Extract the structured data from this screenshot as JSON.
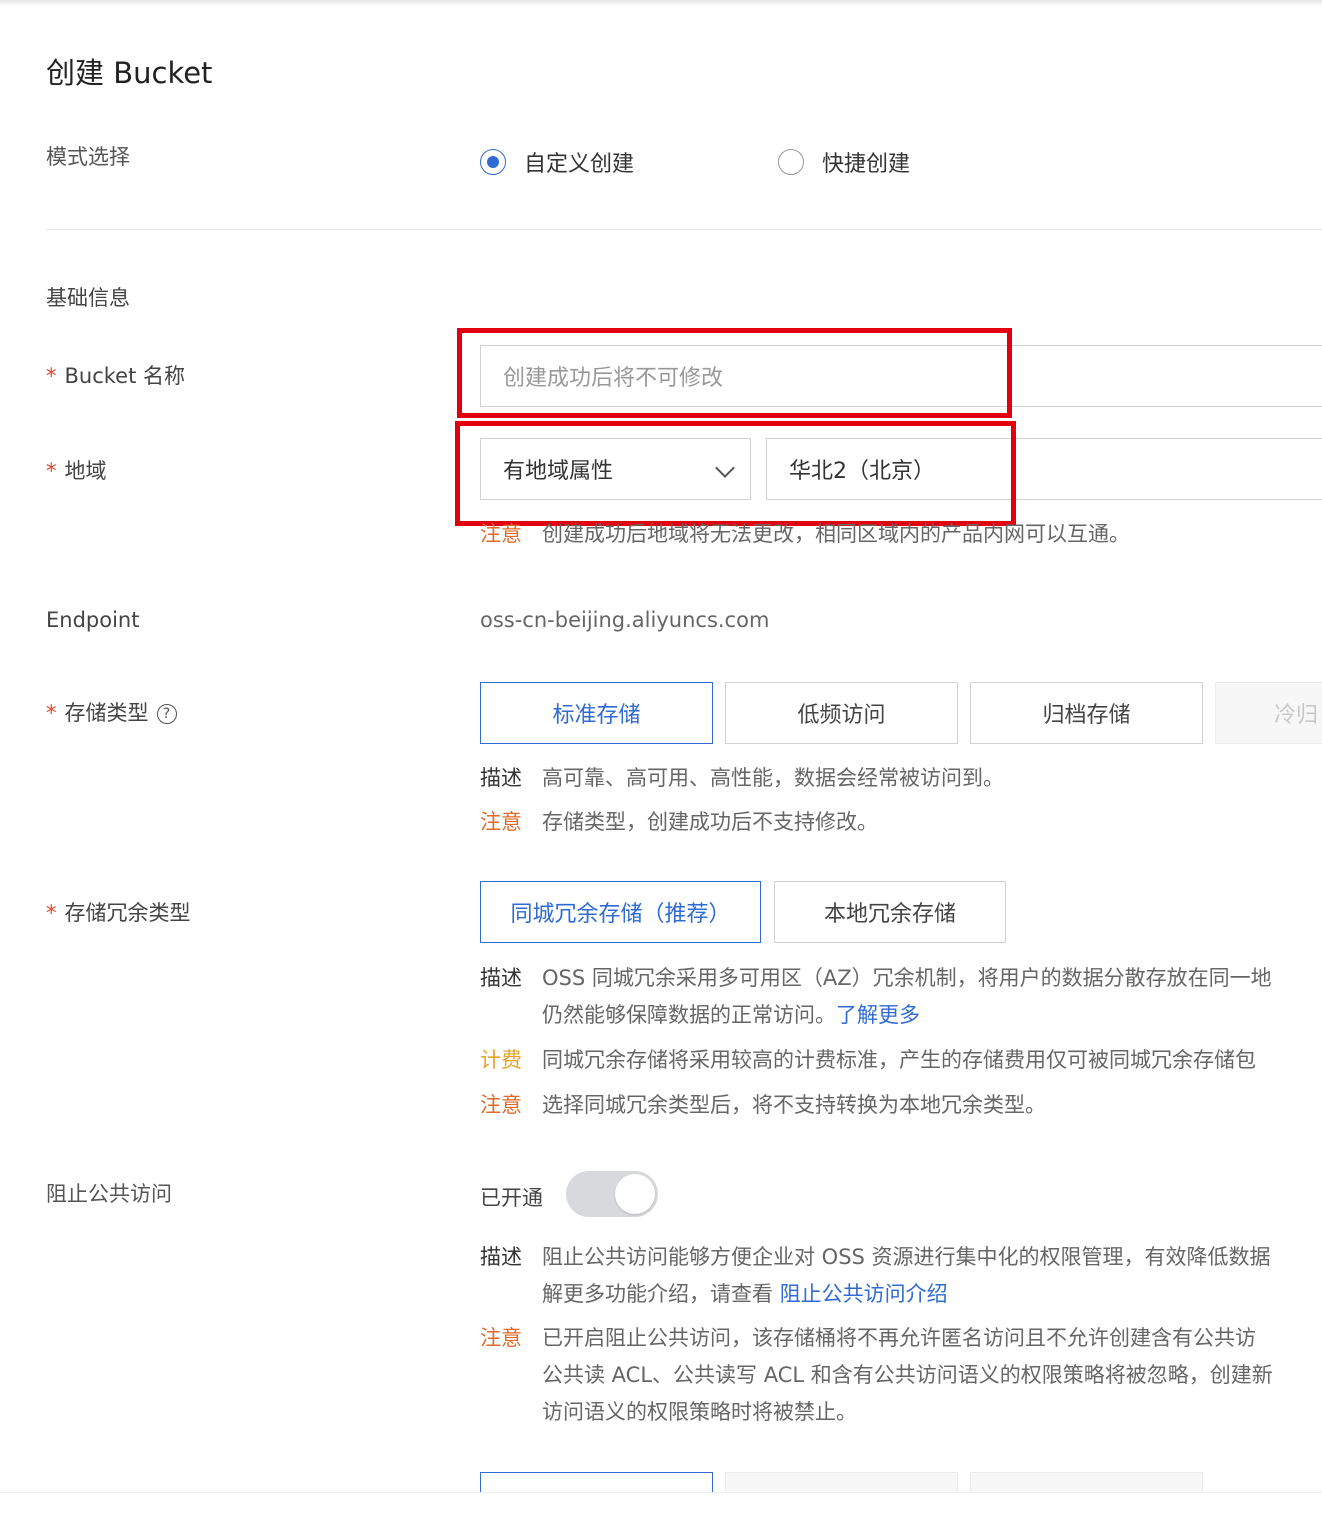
{
  "page": {
    "title": "创建 Bucket"
  },
  "mode": {
    "label": "模式选择",
    "options": [
      "自定义创建",
      "快捷创建"
    ],
    "selected": "自定义创建"
  },
  "basic": {
    "section_title": "基础信息",
    "bucket_name": {
      "required_mark": "*",
      "label": "Bucket 名称",
      "placeholder": "创建成功后将不可修改"
    },
    "region": {
      "required_mark": "*",
      "label": "地域",
      "type_value": "有地域属性",
      "region_value": "华北2（北京）",
      "note_key": "注意",
      "note_text": "创建成功后地域将无法更改，相同区域内的产品内网可以互通。"
    },
    "endpoint": {
      "label": "Endpoint",
      "value": "oss-cn-beijing.aliyuncs.com"
    },
    "storage_class": {
      "required_mark": "*",
      "label": "存储类型",
      "help_icon": "question-circle-icon",
      "options": [
        "标准存储",
        "低频访问",
        "归档存储",
        "冷归"
      ],
      "selected": "标准存储",
      "desc_key": "描述",
      "desc_text": "高可靠、高可用、高性能，数据会经常被访问到。",
      "note_key": "注意",
      "note_text": "存储类型，创建成功后不支持修改。"
    },
    "redundancy": {
      "required_mark": "*",
      "label": "存储冗余类型",
      "options": [
        "同城冗余存储（推荐）",
        "本地冗余存储"
      ],
      "selected": "同城冗余存储（推荐）",
      "desc_key": "描述",
      "desc_line1": "OSS 同城冗余采用多可用区（AZ）冗余机制，将用户的数据分散存放在同一地",
      "desc_line2": "仍然能够保障数据的正常访问。",
      "desc_link": "了解更多",
      "fee_key": "计费",
      "fee_text": "同城冗余存储将采用较高的计费标准，产生的存储费用仅可被同城冗余存储包",
      "note_key": "注意",
      "note_text": "选择同城冗余类型后，将不支持转换为本地冗余类型。"
    },
    "block_public": {
      "label": "阻止公共访问",
      "status": "已开通",
      "desc_key": "描述",
      "desc_line1": "阻止公共访问能够方便企业对 OSS 资源进行集中化的权限管理，有效降低数据",
      "desc_line2": "解更多功能介绍，请查看",
      "desc_link": "阻止公共访问介绍",
      "note_key": "注意",
      "note_line1": "已开启阻止公共访问，该存储桶将不再允许匿名访问且不允许创建含有公共访",
      "note_line2": "公共读 ACL、公共读写 ACL 和含有公共访问语义的权限策略将被忽略，创建新",
      "note_line3": "访问语义的权限策略时将被禁止。"
    }
  }
}
